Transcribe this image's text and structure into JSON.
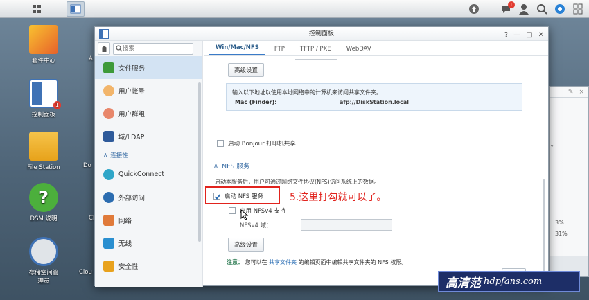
{
  "taskbar": {
    "badge_count": "1"
  },
  "desktop": {
    "icons": [
      {
        "label": "套件中心"
      },
      {
        "label": "控制面板",
        "badge": "1"
      },
      {
        "label": "File Station"
      },
      {
        "label": "DSM 说明"
      },
      {
        "label": "存储空间管理员"
      }
    ],
    "peek_left": [
      "A",
      "Do",
      "Cl",
      "Clou"
    ]
  },
  "window": {
    "title": "控制面板",
    "search_placeholder": "搜索",
    "sidebar": {
      "items": [
        {
          "label": "文件服务",
          "active": true
        },
        {
          "label": "用户帐号"
        },
        {
          "label": "用户群组"
        },
        {
          "label": "域/LDAP"
        }
      ],
      "section": "连接性",
      "connectivity_items": [
        {
          "label": "QuickConnect"
        },
        {
          "label": "外部访问"
        },
        {
          "label": "网络"
        },
        {
          "label": "无线"
        },
        {
          "label": "安全性"
        }
      ]
    },
    "tabs": [
      "Win/Mac/NFS",
      "FTP",
      "TFTP / PXE",
      "WebDAV"
    ],
    "advanced_button_1": "高级设置",
    "info_text": "输入以下地址以使用本地网络中的计算机来访问共享文件夹。",
    "mac_label": "Mac (Finder):",
    "mac_value": "afp://DiskStation.local",
    "bonjour_label": "启动 Bonjour 打印机共享",
    "nfs_section": "NFS 服务",
    "nfs_desc": "启动本服务后，用户可通过网络文件协议(NFS)访问系统上的数据。",
    "nfs_enable_label": "启动 NFS 服务",
    "nfsv4_label": "启用 NFSv4 支持",
    "nfsv4_domain_label": "NFSv4 域：",
    "advanced_button_2": "高级设置",
    "note_label": "注意：",
    "note_text_pre": "您可以在",
    "note_link": "共享文件夹",
    "note_text_post": "的编辑页面中编辑共享文件夹的 NFS 权限。",
    "apply_button": "应用"
  },
  "annotation": {
    "text": "5.这里打勾就可以了。",
    "color": "#e1231d"
  },
  "widget": {
    "values": [
      "3%",
      "31%"
    ],
    "text_fragment": "。"
  },
  "watermark": {
    "text": "hdpfans.com",
    "cn": "高清范"
  }
}
